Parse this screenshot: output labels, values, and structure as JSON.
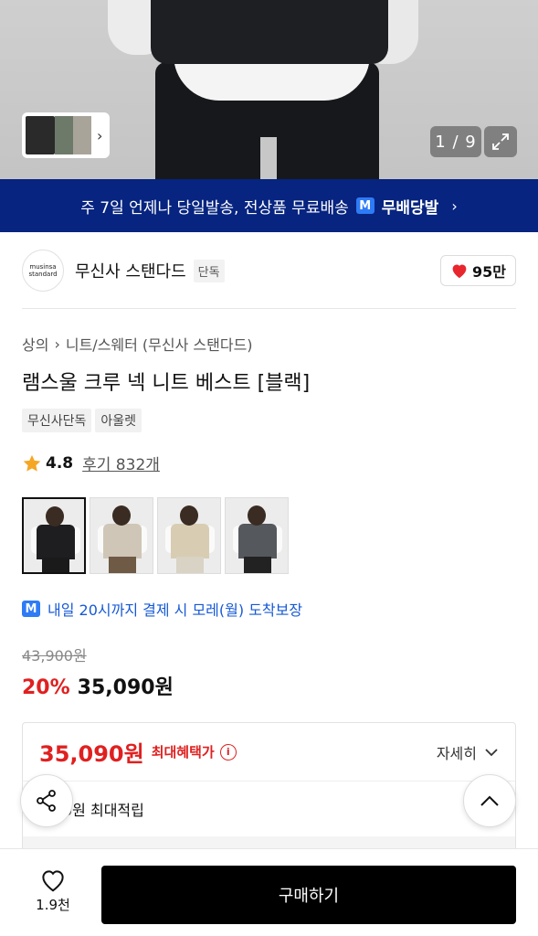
{
  "hero": {
    "counter": "1 / 9"
  },
  "banner": {
    "text": "주 7일 언제나 당일발송, 전상품 무료배송",
    "badge": "M",
    "brand": "무배당발"
  },
  "brand": {
    "logo_line1": "musinsa",
    "logo_line2": "standard",
    "name": "무신사 스탠다드",
    "tag": "단독",
    "likes": "95만"
  },
  "breadcrumb": {
    "category": "상의",
    "subcategory": "니트/스웨터 (무신사 스탠다드)"
  },
  "product": {
    "title": "램스울 크루 넥 니트 베스트 [블랙]",
    "tags": [
      "무신사단독",
      "아울렛"
    ],
    "rating": "4.8",
    "review_label": "후기 832개"
  },
  "swatches": [
    {
      "color": "#1e1e20",
      "legs": "#1a1a1a"
    },
    {
      "color": "#cfc6b7",
      "legs": "#6e5a45"
    },
    {
      "color": "#d8cdb3",
      "legs": "#d9d3c6"
    },
    {
      "color": "#55585d",
      "legs": "#222"
    }
  ],
  "delivery": {
    "badge": "M",
    "text": "내일 20시까지 결제 시 모레(월) 도착보장"
  },
  "price": {
    "original": "43,900원",
    "discount": "20%",
    "sale": "35,090원"
  },
  "benefit": {
    "price": "35,090원",
    "label": "최대혜택가",
    "info": "i",
    "detail": "자세히",
    "points": "0원 최대적립"
  },
  "bottom": {
    "wish_count": "1.9천",
    "buy_label": "구매하기"
  },
  "colors": {
    "banner": "#062480",
    "accent_red": "#e02020",
    "delivery_blue": "#1659d6",
    "buy_button": "#000000"
  }
}
